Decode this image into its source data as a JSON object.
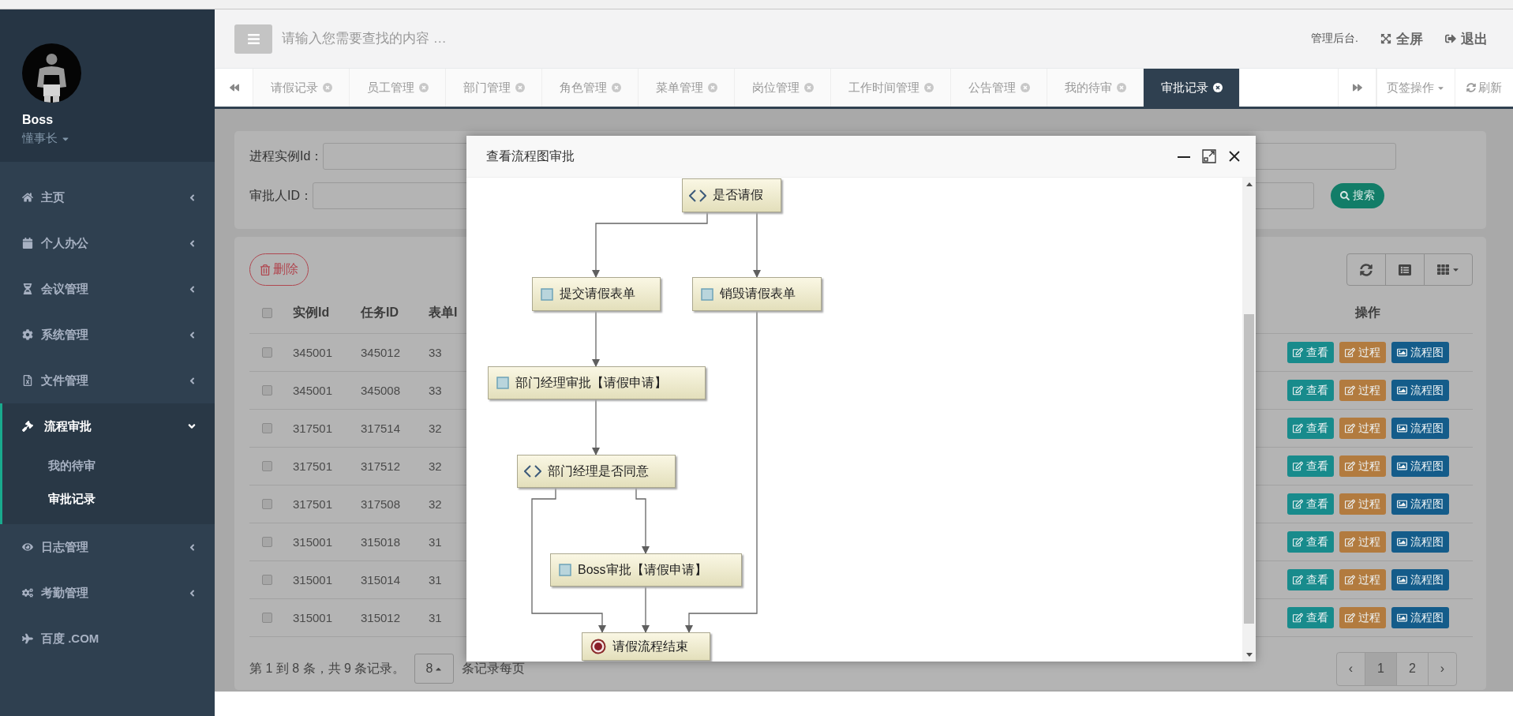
{
  "sidebar": {
    "user": {
      "name": "Boss",
      "role": "懂事长"
    },
    "items": [
      {
        "kind": "group",
        "label": "主页",
        "expanded": false
      },
      {
        "kind": "group",
        "label": "个人办公",
        "expanded": false
      },
      {
        "kind": "group",
        "label": "会议管理",
        "expanded": false
      },
      {
        "kind": "group",
        "label": "系统管理",
        "expanded": false
      },
      {
        "kind": "group",
        "label": "文件管理",
        "expanded": false
      },
      {
        "kind": "group",
        "label": "流程审批",
        "expanded": true,
        "children": [
          {
            "label": "我的待审",
            "selected": false
          },
          {
            "label": "审批记录",
            "selected": true
          }
        ]
      },
      {
        "kind": "group",
        "label": "日志管理",
        "expanded": false
      },
      {
        "kind": "group",
        "label": "考勤管理",
        "expanded": false
      },
      {
        "kind": "link",
        "label": "百度 .COM",
        "expanded": false
      }
    ]
  },
  "header": {
    "search": {
      "placeholder": "请输入您需要查找的内容 …"
    },
    "site_label": "管理后台.",
    "actions": [
      "全屏",
      "退出"
    ]
  },
  "tabs": {
    "items": [
      {
        "label": "请假记录",
        "selected": false
      },
      {
        "label": "员工管理",
        "selected": false
      },
      {
        "label": "部门管理",
        "selected": false
      },
      {
        "label": "角色管理",
        "selected": false
      },
      {
        "label": "菜单管理",
        "selected": false
      },
      {
        "label": "岗位管理",
        "selected": false
      },
      {
        "label": "工作时间管理",
        "selected": false
      },
      {
        "label": "公告管理",
        "selected": false
      },
      {
        "label": "我的待审",
        "selected": false
      },
      {
        "label": "审批记录",
        "selected": true
      }
    ],
    "menu": "页签操作",
    "refresh": "刷新"
  },
  "search_form": {
    "fields": [
      {
        "label": "进程实例Id："
      },
      {
        "label": "审批人ID："
      }
    ],
    "button": "搜索"
  },
  "table": {
    "delete_button": "删除",
    "header_checked": false,
    "columns": [
      "实例Id",
      "任务ID",
      "表单I",
      "操作"
    ],
    "rows": [
      {
        "checked": false,
        "cells": [
          "345001",
          "345012",
          "33"
        ],
        "actions": [
          "查看",
          "过程",
          "流程图"
        ]
      },
      {
        "checked": false,
        "cells": [
          "345001",
          "345008",
          "33"
        ],
        "actions": [
          "查看",
          "过程",
          "流程图"
        ]
      },
      {
        "checked": false,
        "cells": [
          "317501",
          "317514",
          "32"
        ],
        "actions": [
          "查看",
          "过程",
          "流程图"
        ]
      },
      {
        "checked": false,
        "cells": [
          "317501",
          "317512",
          "32"
        ],
        "actions": [
          "查看",
          "过程",
          "流程图"
        ]
      },
      {
        "checked": false,
        "cells": [
          "317501",
          "317508",
          "32"
        ],
        "actions": [
          "查看",
          "过程",
          "流程图"
        ]
      },
      {
        "checked": false,
        "cells": [
          "315001",
          "315018",
          "31"
        ],
        "actions": [
          "查看",
          "过程",
          "流程图"
        ]
      },
      {
        "checked": false,
        "cells": [
          "315001",
          "315014",
          "31"
        ],
        "actions": [
          "查看",
          "过程",
          "流程图"
        ]
      },
      {
        "checked": false,
        "cells": [
          "315001",
          "315012",
          "31"
        ],
        "actions": [
          "查看",
          "过程",
          "流程图"
        ]
      }
    ],
    "summary": "第 1 到 8 条，共 9 条记录。",
    "page_size": "8",
    "page_size_suffix": "条记录每页",
    "pages": [
      {
        "label": "‹",
        "selected": false
      },
      {
        "label": "1",
        "selected": true
      },
      {
        "label": "2",
        "selected": false
      },
      {
        "label": "›",
        "selected": false
      }
    ]
  },
  "modal": {
    "title": "查看流程图审批",
    "nodes": [
      {
        "kind": "gateway",
        "label": "是否请假"
      },
      {
        "kind": "task",
        "label": "提交请假表单"
      },
      {
        "kind": "task",
        "label": "销毁请假表单"
      },
      {
        "kind": "task",
        "label": "部门经理审批【请假申请】"
      },
      {
        "kind": "gateway",
        "label": "部门经理是否同意"
      },
      {
        "kind": "task",
        "label": "Boss审批【请假申请】"
      },
      {
        "kind": "end",
        "label": "请假流程结束"
      }
    ]
  }
}
